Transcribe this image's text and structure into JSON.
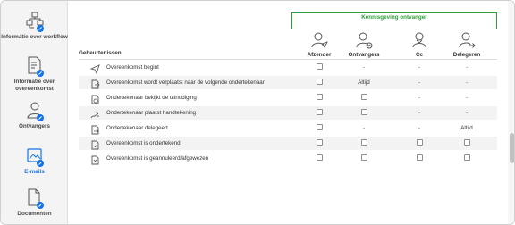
{
  "sidebar": {
    "items": [
      {
        "label": "Informatie over workflow",
        "icon": "workflow-icon",
        "active": false
      },
      {
        "label": "Informatie over overeenkomst",
        "icon": "agreement-info-icon",
        "active": false
      },
      {
        "label": "Ontvangers",
        "icon": "recipients-icon",
        "active": false
      },
      {
        "label": "E-mails",
        "icon": "emails-icon",
        "active": true
      },
      {
        "label": "Documenten",
        "icon": "documents-icon",
        "active": false
      }
    ]
  },
  "main": {
    "group_title": "Kennisgeving ontvanger",
    "events_header": "Gebeurtenissen",
    "columns": [
      {
        "label": "Afzender",
        "icon": "sender-icon"
      },
      {
        "label": "Ontvangers",
        "icon": "recipients-group-icon"
      },
      {
        "label": "Cc",
        "icon": "cc-icon"
      },
      {
        "label": "Delegeren",
        "icon": "delegate-icon"
      }
    ],
    "rows": [
      {
        "label": "Overeenkomst begint",
        "icon": "send-icon",
        "cells": [
          "checkbox",
          "-",
          "-",
          "-"
        ]
      },
      {
        "label": "Overeenkomst wordt verplaatst naar de volgende ondertekenaar",
        "icon": "move-next-icon",
        "cells": [
          "checkbox",
          "Altijd",
          "-",
          "-"
        ]
      },
      {
        "label": "Ondertekenaar bekijkt de uitnodiging",
        "icon": "view-invite-icon",
        "cells": [
          "checkbox",
          "checkbox",
          "-",
          "-"
        ]
      },
      {
        "label": "Ondertekenaar plaatst handtekening",
        "icon": "signature-icon",
        "cells": [
          "checkbox",
          "checkbox",
          "-",
          "-"
        ]
      },
      {
        "label": "Ondertekenaar delegeert",
        "icon": "delegates-icon",
        "cells": [
          "checkbox",
          "-",
          "-",
          "Altijd"
        ]
      },
      {
        "label": "Overeenkomst is ondertekend",
        "icon": "signed-doc-icon",
        "cells": [
          "checkbox",
          "checkbox",
          "checkbox",
          "checkbox"
        ]
      },
      {
        "label": "Overeenkomst is geannuleerd/afgewezen",
        "icon": "cancelled-doc-icon",
        "cells": [
          "checkbox",
          "checkbox",
          "checkbox",
          "checkbox"
        ]
      }
    ]
  },
  "colors": {
    "accent_blue": "#1473e6",
    "group_green": "#2d9d3a",
    "row_shade": "#f3f3f3"
  }
}
